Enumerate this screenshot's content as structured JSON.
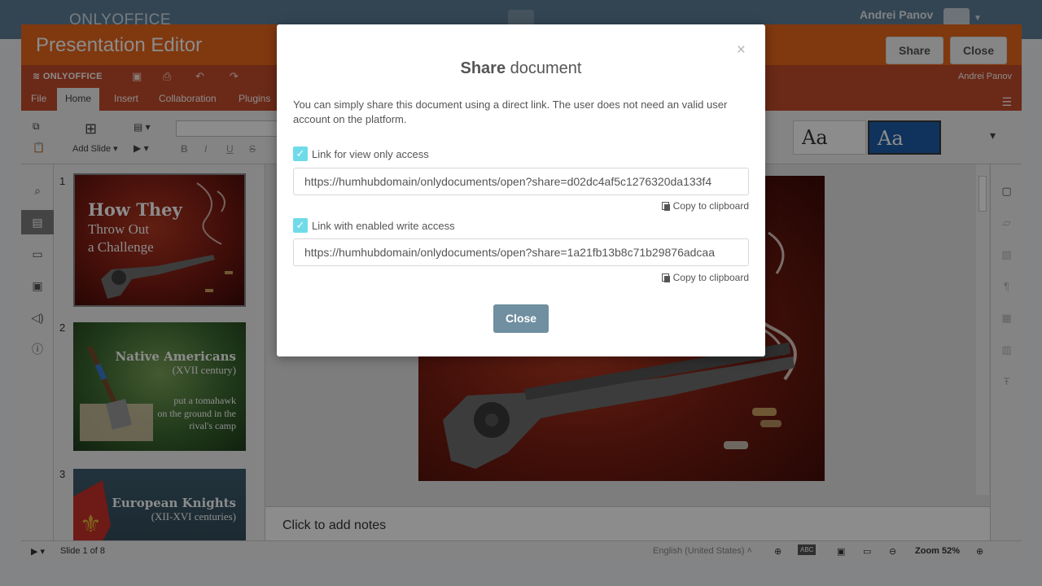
{
  "humhub": {
    "logo": "ONLYOFFICE",
    "user_name": "Andrei Panov"
  },
  "editor": {
    "title": "Presentation Editor",
    "share_button": "Share",
    "close_button": "Close",
    "brand": "ONLYOFFICE",
    "doc_user": "Andrei Panov"
  },
  "menu": {
    "tabs": [
      "File",
      "Home",
      "Insert",
      "Collaboration",
      "Plugins"
    ],
    "active": "Home"
  },
  "toolbar": {
    "add_slide": "Add Slide",
    "bold": "B",
    "italic": "I",
    "underline": "U",
    "strike": "S",
    "theme_label": "Aa"
  },
  "slides": [
    {
      "number": "1",
      "title_lines": [
        "How They",
        "Throw Out",
        "a Challenge"
      ]
    },
    {
      "number": "2",
      "title": "Native Americans",
      "subtitle": "(XVII century)",
      "body_lines": [
        "put a tomahawk",
        "on the ground in the",
        "rival's camp"
      ]
    },
    {
      "number": "3",
      "title": "European Knights",
      "subtitle": "(XII-XVI centuries)"
    }
  ],
  "notes_placeholder": "Click to add notes",
  "status": {
    "slide_info": "Slide 1 of 8",
    "language": "English (United States)",
    "zoom": "Zoom 52%"
  },
  "modal": {
    "title_bold": "Share",
    "title_rest": "document",
    "description": "You can simply share this document using a direct link. The user does not need an valid user account on the platform.",
    "view_label": "Link for view only access",
    "view_link": "https://humhubdomain/onlydocuments/open?share=d02dc4af5c1276320da133f4",
    "edit_label": "Link with enabled write access",
    "edit_link": "https://humhubdomain/onlydocuments/open?share=1a21fb13b8c71b29876adcaa",
    "copy_label": "Copy to clipboard",
    "close_label": "Close",
    "close_x": "×"
  }
}
